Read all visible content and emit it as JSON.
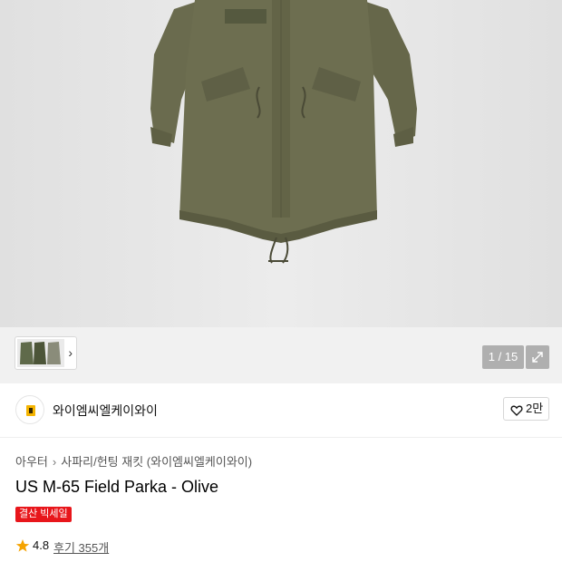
{
  "gallery": {
    "counter": "1 / 15"
  },
  "brand": {
    "name": "와이엠씨엘케이와이",
    "likes": "2만"
  },
  "product": {
    "breadcrumb": [
      "아우터",
      "사파리/헌팅 재킷 (와이엠씨엘케이와이)"
    ],
    "title": "US M-65 Field Parka - Olive",
    "badge": "결산 빅세일",
    "rating": "4.8",
    "reviews": "후기 355개"
  },
  "colors": {
    "badge": "#e8161b",
    "star": "#f5a300",
    "jacket": "#6b6c4f"
  },
  "icons": [
    "heart-icon",
    "star-icon",
    "expand-icon",
    "chevron-right-icon"
  ]
}
